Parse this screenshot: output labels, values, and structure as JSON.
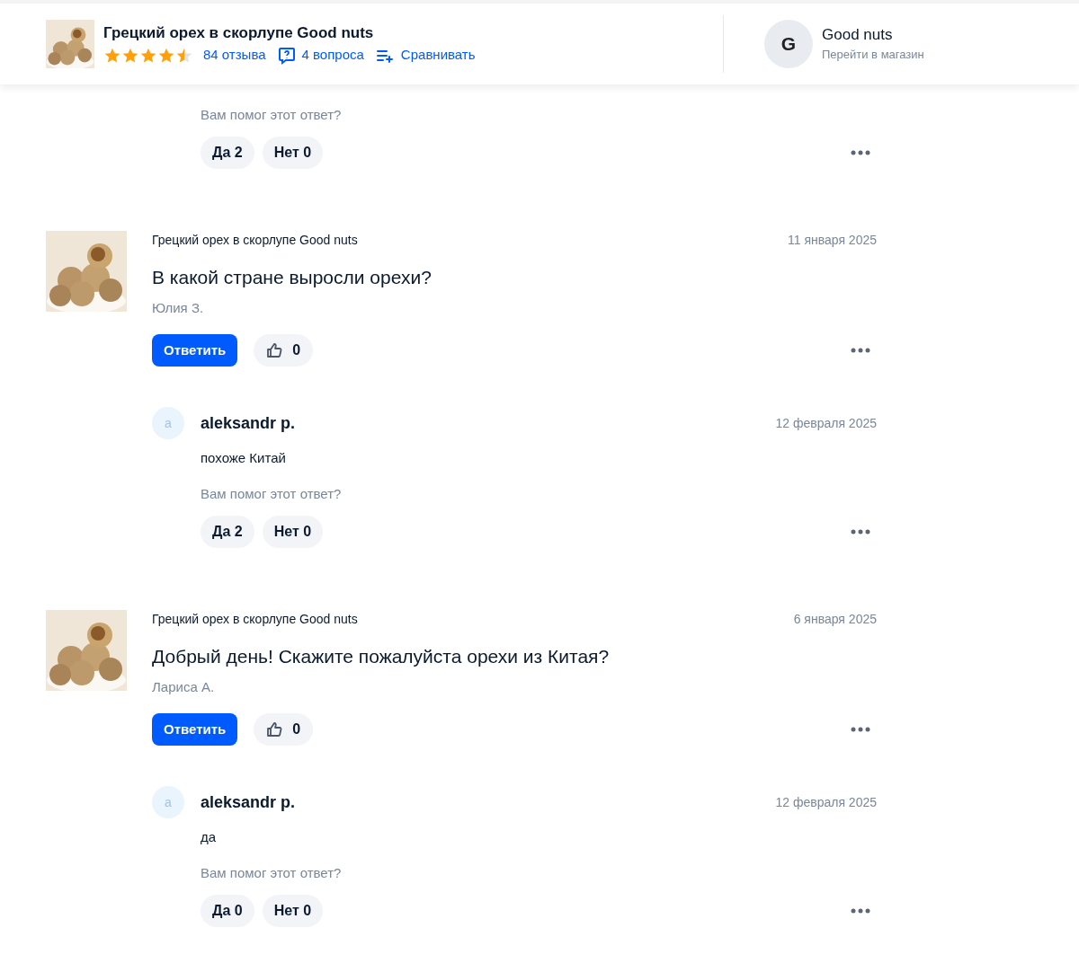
{
  "header": {
    "product_title": "Грецкий орех в скорлупе Good nuts",
    "stars": 4.5,
    "reviews": "84 отзыва",
    "questions": "4 вопроса",
    "compare": "Сравнивать",
    "shop": {
      "initial": "G",
      "name": "Good nuts",
      "link": "Перейти в магазин"
    }
  },
  "partial_answer": {
    "helpful_prompt": "Вам помог этот ответ?",
    "yes": "Да 2",
    "no": "Нет 0"
  },
  "questions": [
    {
      "product": "Грецкий орех в скорлупе Good nuts",
      "date": "11 января 2025",
      "text": "В какой стране выросли орехи?",
      "author": "Юлия З.",
      "reply_button": "Ответить",
      "likes": "0",
      "answers": [
        {
          "initial": "a",
          "author": "aleksandr p.",
          "date": "12 февраля 2025",
          "text": "похоже Китай",
          "helpful_prompt": "Вам помог этот ответ?",
          "yes": "Да 2",
          "no": "Нет 0"
        }
      ]
    },
    {
      "product": "Грецкий орех в скорлупе Good nuts",
      "date": "6 января 2025",
      "text": "Добрый день! Скажите пожалуйста орехи из Китая?",
      "author": "Лариса А.",
      "reply_button": "Ответить",
      "likes": "0",
      "answers": [
        {
          "initial": "a",
          "author": "aleksandr p.",
          "date": "12 февраля 2025",
          "text": "да",
          "helpful_prompt": "Вам помог этот ответ?",
          "yes": "Да 0",
          "no": "Нет 0"
        }
      ]
    }
  ]
}
